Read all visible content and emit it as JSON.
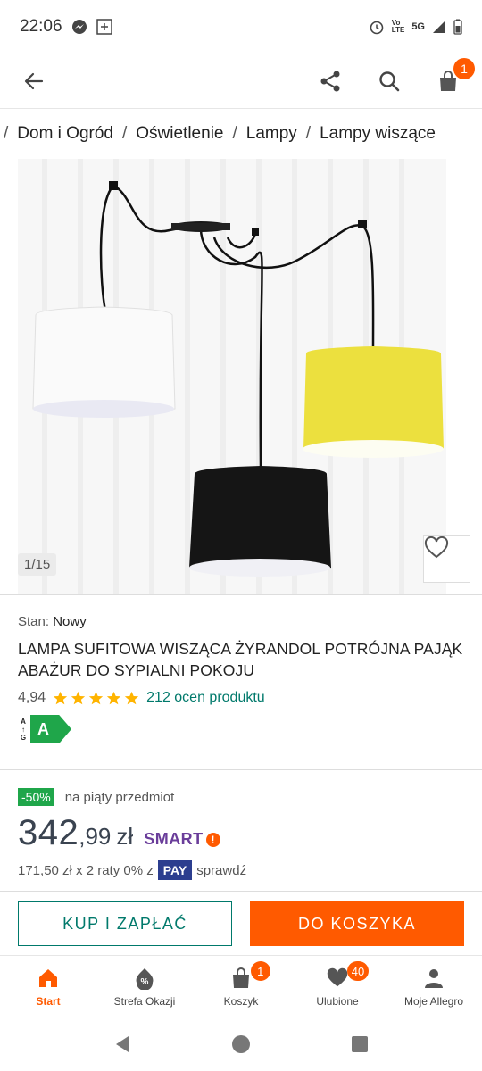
{
  "status_bar": {
    "time": "22:06",
    "network": "5G",
    "volte": "Vo\nLTE"
  },
  "colors": {
    "accent": "#ff5a00",
    "teal": "#00796b",
    "green": "#1fa64a",
    "smart": "#6a3d9a",
    "pay": "#2c3e8f"
  },
  "header": {
    "cart_count": "1"
  },
  "breadcrumb": [
    "Dom i Ogród",
    "Oświetlenie",
    "Lampy",
    "Lampy wiszące"
  ],
  "gallery": {
    "counter": "1/15"
  },
  "product": {
    "condition_label": "Stan:",
    "condition_value": "Nowy",
    "title": "LAMPA SUFITOWA WISZĄCA ŻYRANDOL POTRÓJNA PAJĄK ABAŻUR DO SYPIALNI POKOJU",
    "rating": "4,94",
    "stars": 5,
    "reviews": "212 ocen produktu",
    "energy_scale": "A\n↑\nG",
    "energy_class": "A"
  },
  "price": {
    "promo_badge": "-50%",
    "promo_text": "na piąty przedmiot",
    "main": "342",
    "decimals": ",99",
    "currency": "zł",
    "smart": "SMART",
    "installments": "171,50 zł x 2 raty 0% z",
    "pay": "PAY",
    "check": "sprawdź"
  },
  "actions": {
    "buy": "KUP I ZAPŁAĆ",
    "cart": "DO KOSZYKA"
  },
  "bottom_nav": [
    {
      "label": "Start",
      "icon": "home-icon",
      "badge": ""
    },
    {
      "label": "Strefa Okazji",
      "icon": "deals-icon",
      "badge": ""
    },
    {
      "label": "Koszyk",
      "icon": "bag-icon",
      "badge": "1"
    },
    {
      "label": "Ulubione",
      "icon": "heart-icon",
      "badge": "40"
    },
    {
      "label": "Moje Allegro",
      "icon": "person-icon",
      "badge": ""
    }
  ]
}
